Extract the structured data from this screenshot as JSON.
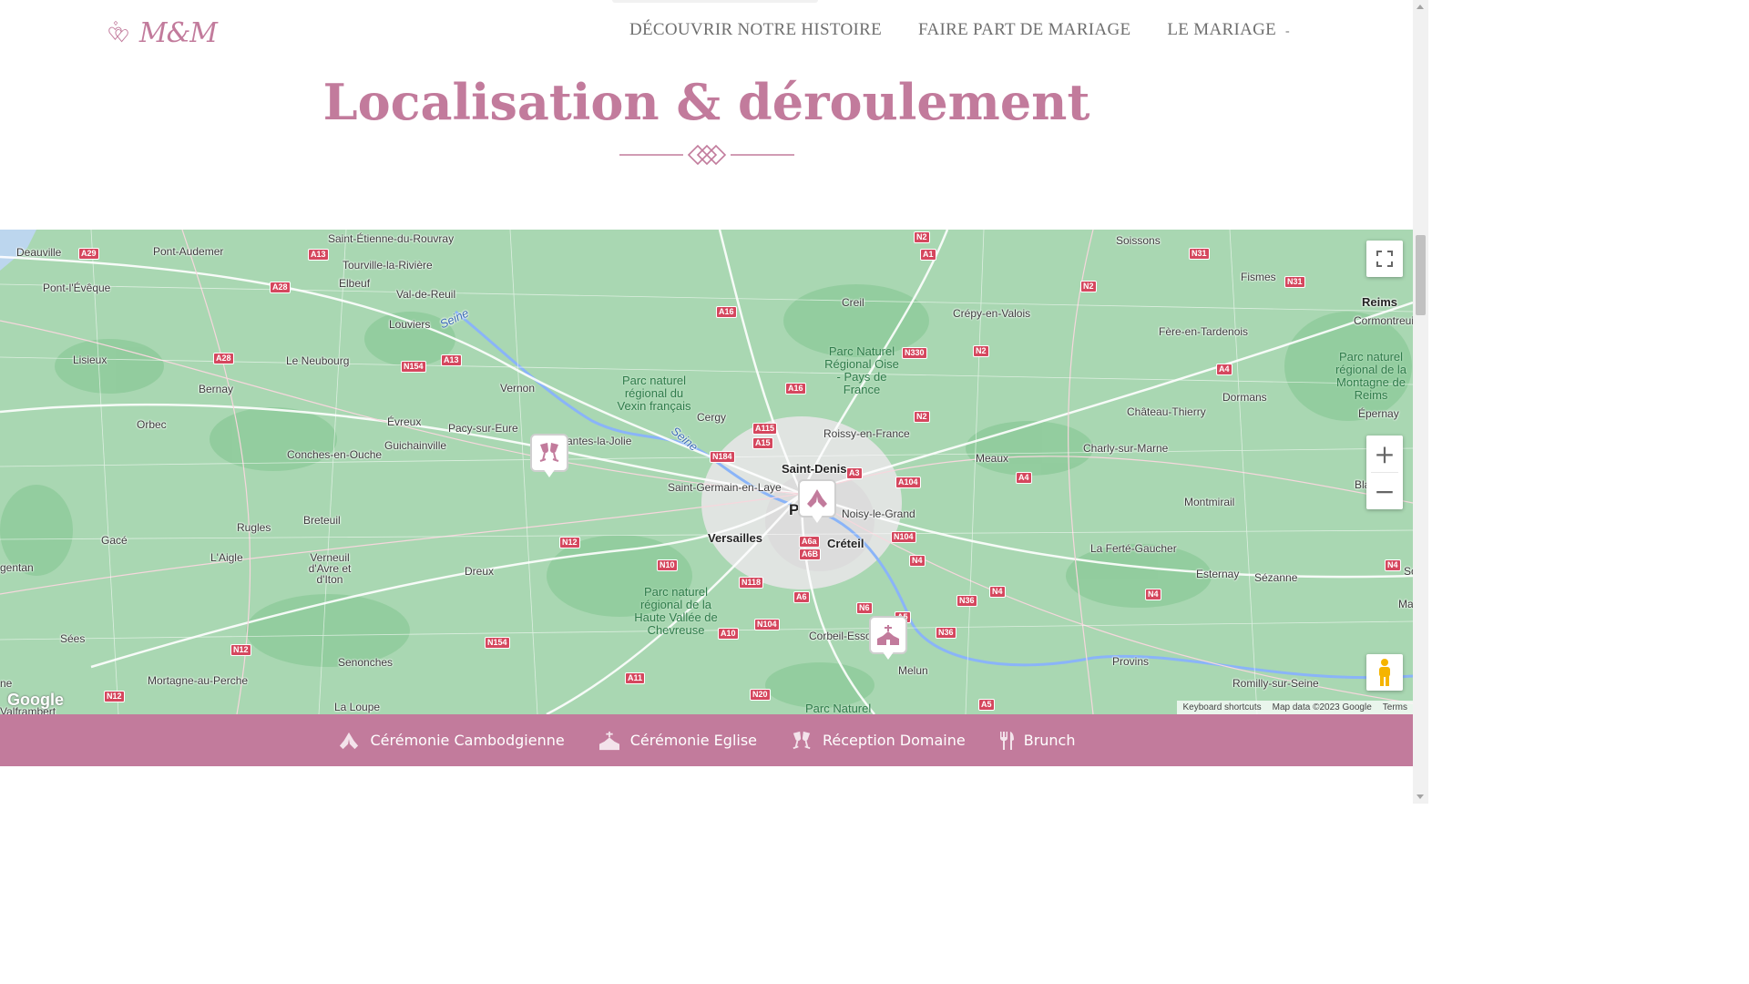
{
  "header": {
    "logo_text": "M&M",
    "nav": [
      {
        "label": "DÉCOUVRIR NOTRE HISTOIRE"
      },
      {
        "label": "FAIRE PART DE MARIAGE"
      },
      {
        "label": "LE MARIAGE"
      }
    ],
    "nav_caret": "-"
  },
  "section": {
    "title": "Localisation & déroulement"
  },
  "map": {
    "places": [
      "Saint-Étienne-du-Rouvray",
      "Deauville",
      "Pont-Audemer",
      "Tourville-la-Rivière",
      "Pont-l'Évêque",
      "Elbeuf",
      "Val-de-Reuil",
      "Louviers",
      "Lisieux",
      "Le Neubourg",
      "Bernay",
      "Vernon",
      "Orbec",
      "Évreux",
      "Pacy-sur-Eure",
      "Guichainville",
      "Conches-en-Ouche",
      "Mantes-la-Jolie",
      "Cergy",
      "Saint-Denis",
      "Roissy-en-France",
      "Saint-Germain-en-Laye",
      "Noisy-le-Grand",
      "Versailles",
      "Créteil",
      "Breteuil",
      "Rugles",
      "Gacé",
      "L'Aigle",
      "Verneuil d'Avre et d'Iton",
      "Dreux",
      "Sées",
      "Senonches",
      "Mortagne-au-Perche",
      "La Loupe",
      "Corbeil-Essonnes",
      "Melun",
      "Creil",
      "Crépy-en-Valois",
      "Soissons",
      "Fismes",
      "Reims",
      "Cormontreuil",
      "Fère-en-Tardenois",
      "Dormans",
      "Château-Thierry",
      "Épernay",
      "Meaux",
      "Charly-sur-Marne",
      "Montmirail",
      "Blancs-",
      "La Ferté-Gaucher",
      "Esternay",
      "Sézanne",
      "Provins",
      "Romilly-sur-Seine",
      "gentan",
      "Valframbert",
      "P",
      "So",
      "Ma",
      "ne"
    ],
    "parks": [
      "Parc naturel régional du Vexin français",
      "Parc Naturel Régional Oise - Pays de France",
      "Parc naturel régional de la Haute Vallée de Chevreuse",
      "Parc naturel régional de la Montagne de Reims",
      "Parc Naturel"
    ],
    "rivers": [
      "Seine",
      "Seine"
    ],
    "roads": [
      "A29",
      "A13",
      "A28",
      "A28",
      "N154",
      "A13",
      "A16",
      "A1",
      "N31",
      "N2",
      "N2",
      "N330",
      "A16",
      "N2",
      "A4",
      "A115",
      "A15",
      "N184",
      "A3",
      "A104",
      "A4",
      "A6a",
      "A6B",
      "N104",
      "N4",
      "N12",
      "N10",
      "N118",
      "A6",
      "N6",
      "A5",
      "N36",
      "N4",
      "N4",
      "N36",
      "A10",
      "N104",
      "N12",
      "N154",
      "A11",
      "N12",
      "N20",
      "A5",
      "N4",
      "N31",
      "N2"
    ],
    "controls": {
      "zoom_in": "+",
      "zoom_out": "−"
    },
    "google_logo": "Google",
    "attribution": {
      "keyboard": "Keyboard shortcuts",
      "data": "Map data ©2023 Google",
      "terms": "Terms"
    },
    "markers": [
      {
        "icon": "toast-glasses-icon"
      },
      {
        "icon": "praying-hands-icon"
      },
      {
        "icon": "church-icon"
      }
    ]
  },
  "legend": [
    {
      "label": "Cérémonie Cambodgienne",
      "icon": "praying-hands-icon"
    },
    {
      "label": "Cérémonie Eglise",
      "icon": "church-icon"
    },
    {
      "label": "Réception Domaine",
      "icon": "toast-glasses-icon"
    },
    {
      "label": "Brunch",
      "icon": "cutlery-icon"
    }
  ],
  "colors": {
    "accent": "#c27b9c",
    "map_green": "#a9d7b2",
    "road_shield": "#d5475e"
  }
}
